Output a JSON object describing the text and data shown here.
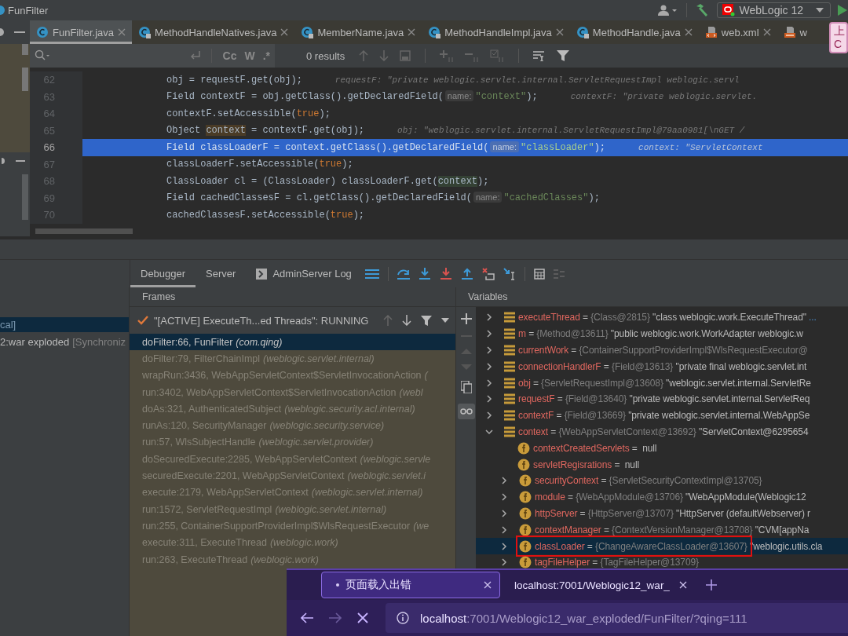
{
  "window": {
    "title": "FunFilter"
  },
  "toolbar": {
    "run_configuration": "WebLogic 12"
  },
  "editor_tabs": [
    {
      "label": "FunFilter.java",
      "kind": "class",
      "selected": true,
      "closable": true
    },
    {
      "label": "MethodHandleNatives.java",
      "kind": "locked-class",
      "selected": false,
      "closable": true
    },
    {
      "label": "MemberName.java",
      "kind": "locked-class",
      "selected": false,
      "closable": true
    },
    {
      "label": "MethodHandleImpl.java",
      "kind": "locked-class",
      "selected": false,
      "closable": true
    },
    {
      "label": "MethodHandle.java",
      "kind": "locked-class",
      "selected": false,
      "closable": true
    },
    {
      "label": "web.xml",
      "kind": "xml",
      "selected": false,
      "closable": true
    },
    {
      "label": "w",
      "kind": "jsp",
      "selected": false,
      "closable": false
    }
  ],
  "tooltip": {
    "lines": [
      "上",
      "C"
    ]
  },
  "find_bar": {
    "options": [
      "Cc",
      "W",
      ".*"
    ],
    "results": "0 results"
  },
  "code": {
    "lines": [
      {
        "number": "62",
        "current": false,
        "segments": [
          {
            "kind": "plain",
            "text": "obj = requestF.get(obj);"
          }
        ],
        "inline_value": "requestF: \"private weblogic.servlet.internal.ServletRequestImpl weblogic.servl"
      },
      {
        "number": "63",
        "current": false,
        "segments": [
          {
            "kind": "plain",
            "text": "Field contextF = obj.getClass().getDeclaredField("
          },
          {
            "kind": "param",
            "text": "name:"
          },
          {
            "kind": "string",
            "text": "\"context\""
          },
          {
            "kind": "plain",
            "text": ");"
          }
        ],
        "inline_value": "contextF: \"private weblogic.servlet."
      },
      {
        "number": "64",
        "current": false,
        "segments": [
          {
            "kind": "plain",
            "text": "contextF.setAccessible("
          },
          {
            "kind": "keyword",
            "text": "true"
          },
          {
            "kind": "plain",
            "text": ");"
          }
        ]
      },
      {
        "number": "65",
        "current": false,
        "segments": [
          {
            "kind": "plain",
            "text": "Object "
          },
          {
            "kind": "write",
            "text": "context"
          },
          {
            "kind": "plain",
            "text": " = contextF.get(obj);"
          }
        ],
        "inline_value": "obj: \"weblogic.servlet.internal.ServletRequestImpl@79aa0981[\\nGET /"
      },
      {
        "number": "66",
        "current": true,
        "segments": [
          {
            "kind": "plain",
            "text": "Field classLoaderF = context.getClass().getDeclaredField("
          },
          {
            "kind": "param",
            "text": "name:"
          },
          {
            "kind": "string",
            "text": "\"classLoader\""
          },
          {
            "kind": "plain",
            "text": ");"
          }
        ],
        "inline_value": "context: \"ServletContext"
      },
      {
        "number": "67",
        "current": false,
        "segments": [
          {
            "kind": "plain",
            "text": "classLoaderF.setAccessible("
          },
          {
            "kind": "keyword",
            "text": "true"
          },
          {
            "kind": "plain",
            "text": ");"
          }
        ]
      },
      {
        "number": "68",
        "current": false,
        "segments": [
          {
            "kind": "plain",
            "text": "ClassLoader cl = (ClassLoader) classLoaderF.get("
          },
          {
            "kind": "read",
            "text": "context"
          },
          {
            "kind": "plain",
            "text": ");"
          }
        ]
      },
      {
        "number": "69",
        "current": false,
        "segments": [
          {
            "kind": "plain",
            "text": "Field cachedClassesF = cl.getClass().getDeclaredField("
          },
          {
            "kind": "param",
            "text": "name:"
          },
          {
            "kind": "string",
            "text": "\"cachedClasses\""
          },
          {
            "kind": "plain",
            "text": ");"
          }
        ]
      },
      {
        "number": "70",
        "current": false,
        "segments": [
          {
            "kind": "plain",
            "text": "cachedClassesF.setAccessible("
          },
          {
            "kind": "keyword",
            "text": "true"
          },
          {
            "kind": "plain",
            "text": ");"
          }
        ]
      }
    ]
  },
  "debug_tabs": [
    {
      "label": "Debugger",
      "kind": "plain",
      "selected": true
    },
    {
      "label": "Server",
      "kind": "plain",
      "selected": false
    },
    {
      "label": "AdminServer Log",
      "kind": "console",
      "selected": false
    }
  ],
  "services": [
    {
      "text": "cal]",
      "selected": true
    },
    {
      "text": "2:war exploded",
      "note": "[Synchroniz",
      "selected": false
    }
  ],
  "frames": {
    "title": "Frames",
    "thread": "\"[ACTIVE] ExecuteTh...ed Threads\": RUNNING",
    "items": [
      {
        "location": "doFilter:66, FunFilter",
        "package": "(com.qing)",
        "selected": true
      },
      {
        "location": "doFilter:79, FilterChainImpl",
        "package": "(weblogic.servlet.internal)",
        "selected": false
      },
      {
        "location": "wrapRun:3436, WebAppServletContext$ServletInvocationAction",
        "package": "(",
        "selected": false
      },
      {
        "location": "run:3402, WebAppServletContext$ServletInvocationAction",
        "package": "(webl",
        "selected": false
      },
      {
        "location": "doAs:321, AuthenticatedSubject",
        "package": "(weblogic.security.acl.internal)",
        "selected": false
      },
      {
        "location": "runAs:120, SecurityManager",
        "package": "(weblogic.security.service)",
        "selected": false
      },
      {
        "location": "run:57, WlsSubjectHandle",
        "package": "(weblogic.servlet.provider)",
        "selected": false
      },
      {
        "location": "doSecuredExecute:2285, WebAppServletContext",
        "package": "(weblogic.servle",
        "selected": false
      },
      {
        "location": "securedExecute:2201, WebAppServletContext",
        "package": "(weblogic.servlet.i",
        "selected": false
      },
      {
        "location": "execute:2179, WebAppServletContext",
        "package": "(weblogic.servlet.internal)",
        "selected": false
      },
      {
        "location": "run:1572, ServletRequestImpl",
        "package": "(weblogic.servlet.internal)",
        "selected": false
      },
      {
        "location": "run:255, ContainerSupportProviderImpl$WlsRequestExecutor",
        "package": "(we",
        "selected": false
      },
      {
        "location": "execute:311, ExecuteThread",
        "package": "(weblogic.work)",
        "selected": false
      },
      {
        "location": "run:263, ExecuteThread",
        "package": "(weblogic.work)",
        "selected": false
      }
    ]
  },
  "variables": {
    "title": "Variables",
    "items": [
      {
        "name": "executeThread",
        "operator": "=",
        "type": "{Class@2815}",
        "value": "\"class weblogic.work.ExecuteThread\"",
        "more": "...",
        "kind": "local",
        "expandable": true,
        "expanded": false,
        "selected": false,
        "marked": false
      },
      {
        "name": "m",
        "operator": "=",
        "type": "{Method@13611}",
        "value": "\"public weblogic.work.WorkAdapter weblogic.w",
        "kind": "local",
        "expandable": true,
        "expanded": false,
        "selected": false,
        "marked": false
      },
      {
        "name": "currentWork",
        "operator": "=",
        "type": "{ContainerSupportProviderImpl$WlsRequestExecutor@",
        "kind": "local",
        "expandable": true,
        "expanded": false,
        "selected": false,
        "marked": false
      },
      {
        "name": "connectionHandlerF",
        "operator": "=",
        "type": "{Field@13613}",
        "value": "\"private final weblogic.servlet.int",
        "kind": "local",
        "expandable": true,
        "expanded": false,
        "selected": false,
        "marked": false
      },
      {
        "name": "obj",
        "operator": "=",
        "type": "{ServletRequestImpl@13608}",
        "value": "\"weblogic.servlet.internal.ServletRe",
        "kind": "local",
        "expandable": true,
        "expanded": false,
        "selected": false,
        "marked": false
      },
      {
        "name": "requestF",
        "operator": "=",
        "type": "{Field@13640}",
        "value": "\"private weblogic.servlet.internal.ServletReq",
        "kind": "local",
        "expandable": true,
        "expanded": false,
        "selected": false,
        "marked": false
      },
      {
        "name": "contextF",
        "operator": "=",
        "type": "{Field@13669}",
        "value": "\"private weblogic.servlet.internal.WebAppSe",
        "kind": "local",
        "expandable": true,
        "expanded": false,
        "selected": false,
        "marked": false
      },
      {
        "name": "context",
        "operator": "=",
        "type": "{WebAppServletContext@13692}",
        "value": "\"ServletContext@6295654",
        "kind": "local",
        "expandable": true,
        "expanded": true,
        "selected": false,
        "marked": false,
        "children": [
          {
            "name": "contextCreatedServlets",
            "operator": "=",
            "value": "null",
            "kind": "field",
            "expandable": false,
            "selected": false,
            "marked": false
          },
          {
            "name": "servletRegisrations",
            "operator": "=",
            "value": "null",
            "kind": "field",
            "expandable": false,
            "selected": false,
            "marked": false
          },
          {
            "name": "securityContext",
            "operator": "=",
            "type": "{ServletSecurityContextImpl@13705}",
            "kind": "field",
            "expandable": true,
            "expanded": false,
            "selected": false,
            "marked": false
          },
          {
            "name": "module",
            "operator": "=",
            "type": "{WebAppModule@13706}",
            "value": "\"WebAppModule(Weblogic12",
            "kind": "field",
            "expandable": true,
            "expanded": false,
            "selected": false,
            "marked": false
          },
          {
            "name": "httpServer",
            "operator": "=",
            "type": "{HttpServer@13707}",
            "value": "\"HttpServer (defaultWebserver) r",
            "kind": "field",
            "expandable": true,
            "expanded": false,
            "selected": false,
            "marked": false
          },
          {
            "name": "contextManager",
            "operator": "=",
            "type": "{ContextVersionManager@13708}",
            "value": "\"CVM[appNa",
            "kind": "field",
            "expandable": true,
            "expanded": false,
            "selected": false,
            "marked": false
          },
          {
            "name": "classLoader",
            "operator": "=",
            "type": "{ChangeAwareClassLoader@13607}",
            "value": "\"weblogic.utils.cla",
            "kind": "field",
            "expandable": true,
            "expanded": false,
            "selected": true,
            "marked": true
          },
          {
            "name": "tagFileHelper",
            "operator": "=",
            "type": "{TagFileHelper@13709}",
            "kind": "field",
            "expandable": true,
            "expanded": false,
            "selected": false,
            "marked": false
          }
        ]
      }
    ]
  },
  "browser": {
    "tabs": [
      {
        "label": "页面载入出错",
        "selected": true
      },
      {
        "label": "localhost:7001/Weblogic12_war_",
        "selected": false
      }
    ],
    "address": {
      "host": "localhost",
      "path": ":7001/Weblogic12_war_exploded/FunFilter/?qing=111"
    }
  }
}
